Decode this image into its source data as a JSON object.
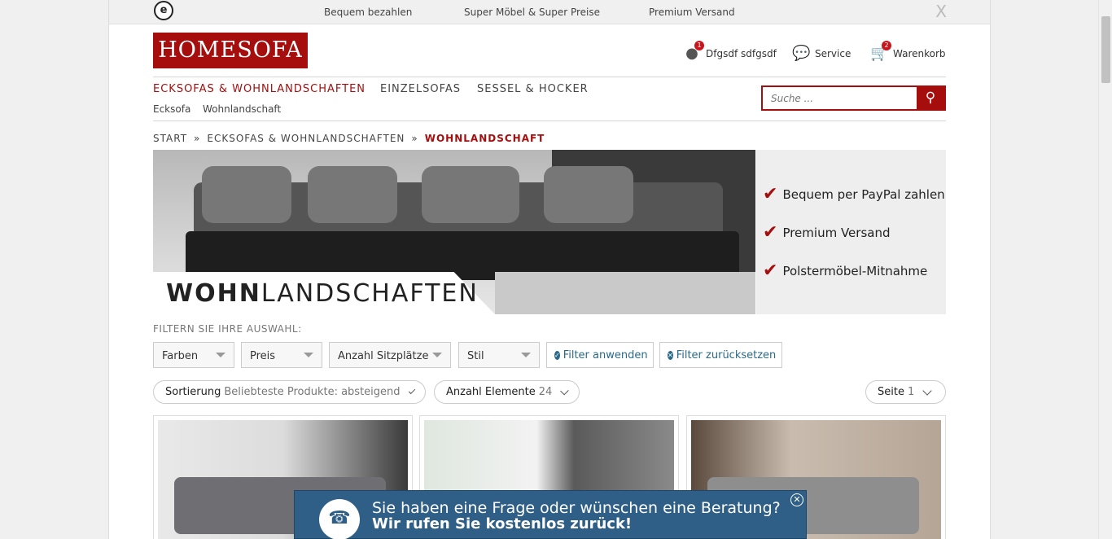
{
  "topbar": {
    "seal_letter": "e",
    "usps": [
      "Bequem bezahlen",
      "Super Möbel & Super Preise",
      "Premium Versand"
    ],
    "close": "X"
  },
  "header": {
    "logo": "HOMESOFA",
    "account": {
      "label": "Dfgsdf sdfgsdf",
      "badge": "1",
      "icon": "user-icon"
    },
    "service": {
      "label": "Service",
      "icon": "chat-bubbles-icon"
    },
    "cart": {
      "label": "Warenkorb",
      "badge": "2",
      "icon": "cart-icon"
    }
  },
  "nav": {
    "main": [
      "ECKSOFAS & WOHNLANDSCHAFTEN",
      "EINZELSOFAS",
      "SESSEL & HOCKER"
    ],
    "sub": [
      "Ecksofa",
      "Wohnlandschaft"
    ]
  },
  "search": {
    "placeholder": "Suche ...",
    "icon": "search-icon"
  },
  "breadcrumb": {
    "items": [
      "START",
      "ECKSOFAS & WOHNLANDSCHAFTEN",
      "WOHNLANDSCHAFT"
    ],
    "separator": "»"
  },
  "hero": {
    "title_bold": "WOHN",
    "title_rest": "LANDSCHAFTEN",
    "promos": [
      "Bequem per PayPal zahlen",
      "Premium Versand",
      "Polstermöbel-Mitnahme"
    ]
  },
  "filters": {
    "label": "FILTERN SIE IHRE AUSWAHL:",
    "dropdowns": [
      "Farben",
      "Preis",
      "Anzahl Sitzplätze",
      "Stil"
    ],
    "apply": "Filter anwenden",
    "reset": "Filter zurücksetzen"
  },
  "sorting": {
    "sort_label": "Sortierung",
    "sort_value": "Beliebteste Produkte: absteigend",
    "count_label": "Anzahl Elemente",
    "count_value": "24",
    "page_label": "Seite",
    "page_value": "1"
  },
  "chat_banner": {
    "line1": "Sie haben eine Frage oder wünschen eine Beratung?",
    "line2": "Wir rufen Sie kostenlos zurück!",
    "icon": "headset-icon",
    "close_icon": "close-circle-icon"
  },
  "colors": {
    "brand": "#a60d0d",
    "link": "#2a6a8a",
    "chat_bg": "#2f5f86"
  }
}
